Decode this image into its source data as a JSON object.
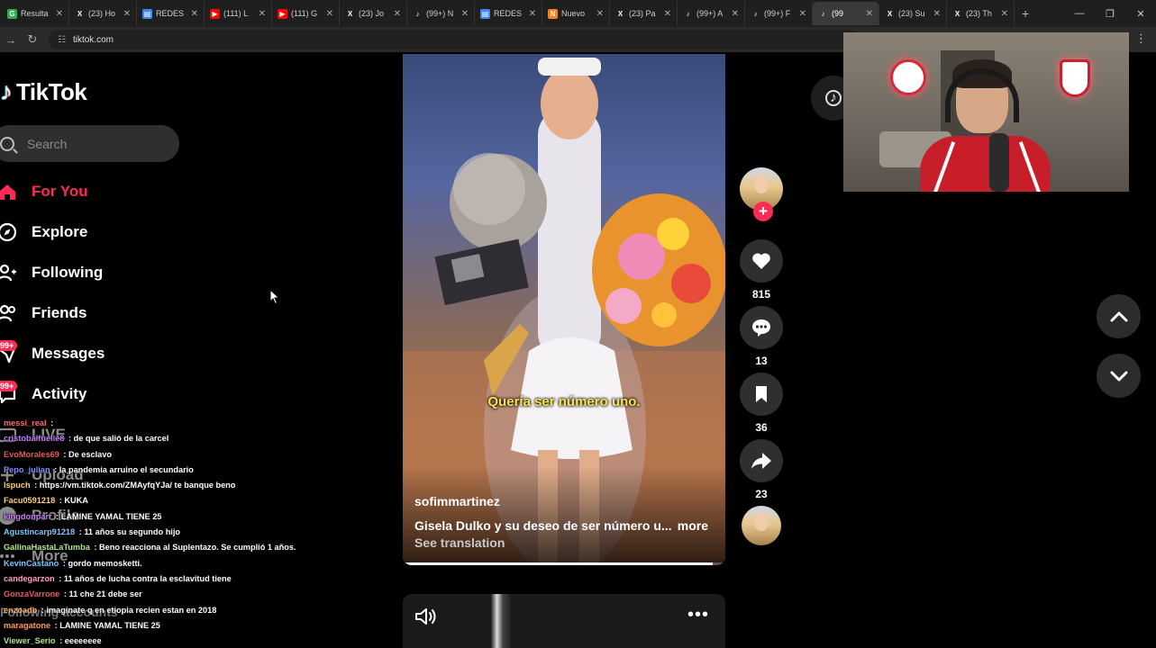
{
  "browser": {
    "tabs": [
      {
        "label": "Resulta",
        "favicon": "G",
        "color": "#34a853"
      },
      {
        "label": "(23) Ho",
        "favicon": "X",
        "color": "#000000"
      },
      {
        "label": "REDES",
        "favicon": "▤",
        "color": "#4285f4"
      },
      {
        "label": "(111) L",
        "favicon": "▶",
        "color": "#ff0000"
      },
      {
        "label": "(111) G",
        "favicon": "▶",
        "color": "#ff0000"
      },
      {
        "label": "(23) Jo",
        "favicon": "X",
        "color": "#000000"
      },
      {
        "label": "(99+) N",
        "favicon": "♪",
        "color": "#000000"
      },
      {
        "label": "REDES",
        "favicon": "▤",
        "color": "#4285f4"
      },
      {
        "label": "Nuevo",
        "favicon": "N",
        "color": "#f58025"
      },
      {
        "label": "(23) Pa",
        "favicon": "X",
        "color": "#000000"
      },
      {
        "label": "(99+) A",
        "favicon": "♪",
        "color": "#000000"
      },
      {
        "label": "(99+) F",
        "favicon": "♪",
        "color": "#000000"
      },
      {
        "label": "(99",
        "favicon": "♪",
        "color": "#000000",
        "active": true
      },
      {
        "label": "(23) Su",
        "favicon": "X",
        "color": "#000000"
      },
      {
        "label": "(23) Th",
        "favicon": "X",
        "color": "#000000"
      }
    ],
    "new_tab": "+",
    "url": "tiktok.com"
  },
  "sidebar": {
    "logo_text": "TikTok",
    "search_placeholder": "Search",
    "items": [
      {
        "label": "For You",
        "icon": "home-icon",
        "active": true
      },
      {
        "label": "Explore",
        "icon": "compass-icon"
      },
      {
        "label": "Following",
        "icon": "following-icon"
      },
      {
        "label": "Friends",
        "icon": "friends-icon"
      },
      {
        "label": "Messages",
        "icon": "messages-icon",
        "badge": "99+"
      },
      {
        "label": "Activity",
        "icon": "activity-icon",
        "badge": "99+"
      },
      {
        "label": "LIVE",
        "icon": "live-icon"
      },
      {
        "label": "Upload",
        "icon": "upload-icon"
      },
      {
        "label": "Profile",
        "icon": "profile-icon"
      },
      {
        "label": "More",
        "icon": "more-icon"
      }
    ],
    "following_accounts": "Following accounts"
  },
  "chat": [
    {
      "user": "messi_real",
      "msg": "",
      "color": "#ff6b6b"
    },
    {
      "user": "cristobalfuelle8",
      "msg": "de que salió de la carcel",
      "color": "#c77dff"
    },
    {
      "user": "EvoMorales69",
      "msg": "De esclavo",
      "color": "#e85a5a"
    },
    {
      "user": "Pepo_julian",
      "msg": "la pandemia arruino el secundario",
      "color": "#7c8cff"
    },
    {
      "user": "lspuch",
      "msg": "https://vm.tiktok.com/ZMAyfqYJa/ te banque beno",
      "color": "#ffd166"
    },
    {
      "user": "Facu0591218",
      "msg": "KUKA",
      "color": "#ffd166"
    },
    {
      "user": "kingdonparr",
      "msg": "LAMINE YAMAL TIENE 25",
      "color": "#c77dff"
    },
    {
      "user": "Agustincarp91218",
      "msg": "11 años su segundo hijo",
      "color": "#7cc7ff"
    },
    {
      "user": "GallinaHastaLaTumba",
      "msg": "Beno reacciona al Suplentazo. Se cumplió 1 años.",
      "color": "#b5e48c"
    },
    {
      "user": "KevinCastano",
      "msg": "gordo memosketti.",
      "color": "#7cc7ff"
    },
    {
      "user": "candegarzon",
      "msg": "11 años de lucha contra la esclavitud tiene",
      "color": "#ff9ecf"
    },
    {
      "user": "GonzaVarrone",
      "msg": "11 che 21 debe ser",
      "color": "#e85a5a"
    },
    {
      "user": "enzoadb",
      "msg": "imaginate q en etiopia recien estan en 2018",
      "color": "#ffa94d"
    },
    {
      "user": "maragatone",
      "msg": "LAMINE YAMAL TIENE 25",
      "color": "#ff9e4d"
    },
    {
      "user": "Viewer_Serio",
      "msg": "eeeeeeee",
      "color": "#b5e48c"
    }
  ],
  "video": {
    "subtitle": "Quería ser número uno.",
    "author": "sofimmartinez",
    "description": "Gisela Dulko y su deseo de ser número u...",
    "more_label": "more",
    "translate_label": "See translation",
    "progress": 0.96
  },
  "actions": {
    "likes": "815",
    "comments": "13",
    "saves": "36",
    "shares": "23"
  },
  "colors": {
    "accent": "#fe2c55",
    "background": "#000000"
  }
}
